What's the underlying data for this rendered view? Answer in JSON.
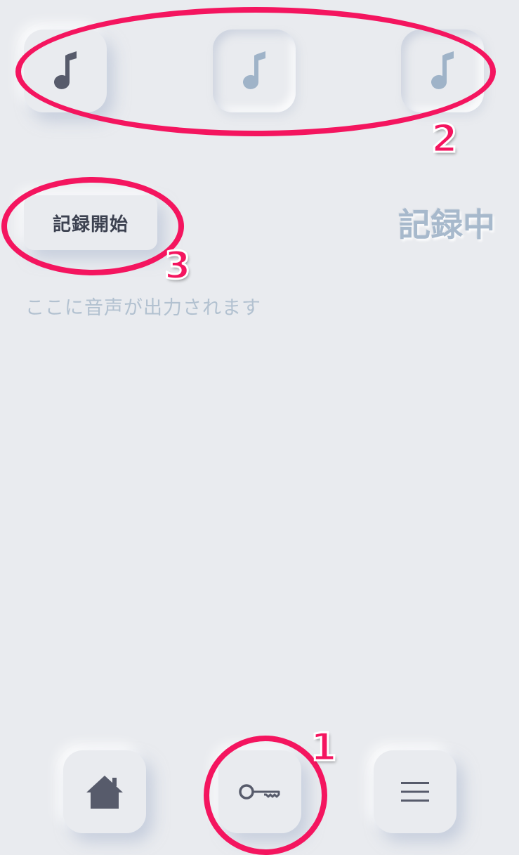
{
  "tones": [
    {
      "name": "note-icon",
      "color": "#575b6b"
    },
    {
      "name": "note-icon",
      "color": "#9fb3c8"
    },
    {
      "name": "note-icon",
      "color": "#9fb3c8"
    }
  ],
  "record": {
    "start_label": "記録開始",
    "status": "記録中",
    "output_placeholder": "ここに音声が出力されます"
  },
  "bottom_nav": {
    "home_icon": "home-icon",
    "key_icon": "key-icon",
    "menu_icon": "menu-icon"
  },
  "annotations": {
    "one": "1",
    "two": "2",
    "three": "3",
    "color": "#f4155f"
  }
}
